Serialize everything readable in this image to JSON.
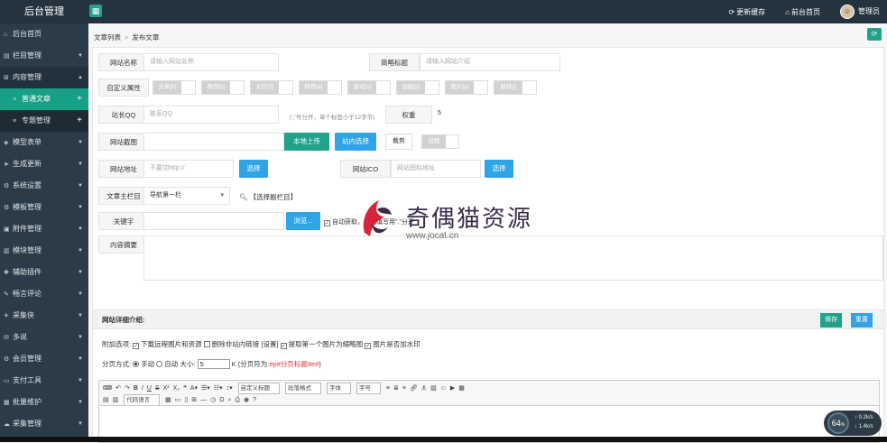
{
  "app": {
    "title": "后台管理"
  },
  "topbar": {
    "update_cache": "更新缓存",
    "frontend_home": "前台首页",
    "admin_name": "管理员"
  },
  "sidebar": {
    "items": [
      {
        "label": "后台首页",
        "icon": "home-icon"
      },
      {
        "label": "栏目管理",
        "icon": "columns-icon"
      },
      {
        "label": "内容管理",
        "icon": "content-icon"
      },
      {
        "label": "普通文章",
        "icon": "list-icon"
      },
      {
        "label": "专题管理",
        "icon": "list-icon"
      },
      {
        "label": "模型表单",
        "icon": "model-icon"
      },
      {
        "label": "生成更新",
        "icon": "generate-icon"
      },
      {
        "label": "系统设置",
        "icon": "gear-icon"
      },
      {
        "label": "模板管理",
        "icon": "template-icon"
      },
      {
        "label": "附件管理",
        "icon": "attachment-icon"
      },
      {
        "label": "模块管理",
        "icon": "module-icon"
      },
      {
        "label": "辅助插件",
        "icon": "plugin-icon"
      },
      {
        "label": "畅言评论",
        "icon": "comment-icon"
      },
      {
        "label": "采集侠",
        "icon": "collect-icon"
      },
      {
        "label": "多说",
        "icon": "chat-icon"
      },
      {
        "label": "会员管理",
        "icon": "member-icon"
      },
      {
        "label": "支付工具",
        "icon": "pay-icon"
      },
      {
        "label": "批量维护",
        "icon": "batch-icon"
      },
      {
        "label": "采集管理",
        "icon": "collect-manage-icon"
      }
    ]
  },
  "breadcrumb": {
    "parent": "文章列表",
    "sep": ">",
    "current": "发布文章"
  },
  "form": {
    "site_name_label": "网站名称",
    "site_name_placeholder": "请输入网站名称",
    "short_title_label": "简略标题",
    "short_title_placeholder": "请输入网站介绍",
    "custom_attr_label": "自定义属性",
    "attrs": [
      "头条[h]",
      "推荐[c]",
      "幻灯[f]",
      "特荐[a]",
      "滚动[s]",
      "加粗[b]",
      "图片[p]",
      "跳转[j]"
    ],
    "qq_label": "站长QQ",
    "qq_placeholder": "联系QQ",
    "qq_note": "(‘,’号分开，单个标签小于12字节)",
    "weight_label": "权重",
    "weight_value": "5",
    "thumb_label": "网站截图",
    "local_upload": "本地上传",
    "site_select": "站内选择",
    "crop": "裁剪",
    "remote": "远程",
    "url_label": "网站地址",
    "url_placeholder": "不要加http://",
    "url_select": "选择",
    "ico_label": "网站ICO",
    "ico_placeholder": "网站图标地址",
    "ico_select": "选择",
    "main_column_label": "文章主栏目",
    "main_column_value": "导航第一栏",
    "pick_sub": "【选择副栏目】",
    "keyword_label": "关键字",
    "browse": "浏览...",
    "auto_fetch": "自动获取，手动填写用\",\"分开",
    "summary_label": "内容摘要",
    "detail_label": "网站详细介绍:",
    "save": "保存",
    "reset": "重置",
    "extra_label": "附加选项:",
    "extra_opts": [
      "下载远程图片和资源",
      "删除非站内链接 [设置]",
      "提取第一个图片为缩略图",
      "图片是否加水印"
    ],
    "paging_label": "分页方式:",
    "manual": "手动",
    "auto": "自动",
    "size_label": "大小:",
    "size_value": "5",
    "size_unit": "K",
    "paging_sep": "(分页符为:",
    "paging_code": "#p#分页标题#e#",
    "paging_end": ")"
  },
  "editor": {
    "row1_selects": [
      "自定义标题",
      "段落格式",
      "字体",
      "字号"
    ],
    "row2_select": "代码语言"
  },
  "watermark": {
    "text": "奇偶猫资源",
    "url": "www.jocat.cn"
  },
  "speed": {
    "value": "64",
    "unit": "%",
    "up": "0.2k/s",
    "down": "1.4k/s"
  }
}
